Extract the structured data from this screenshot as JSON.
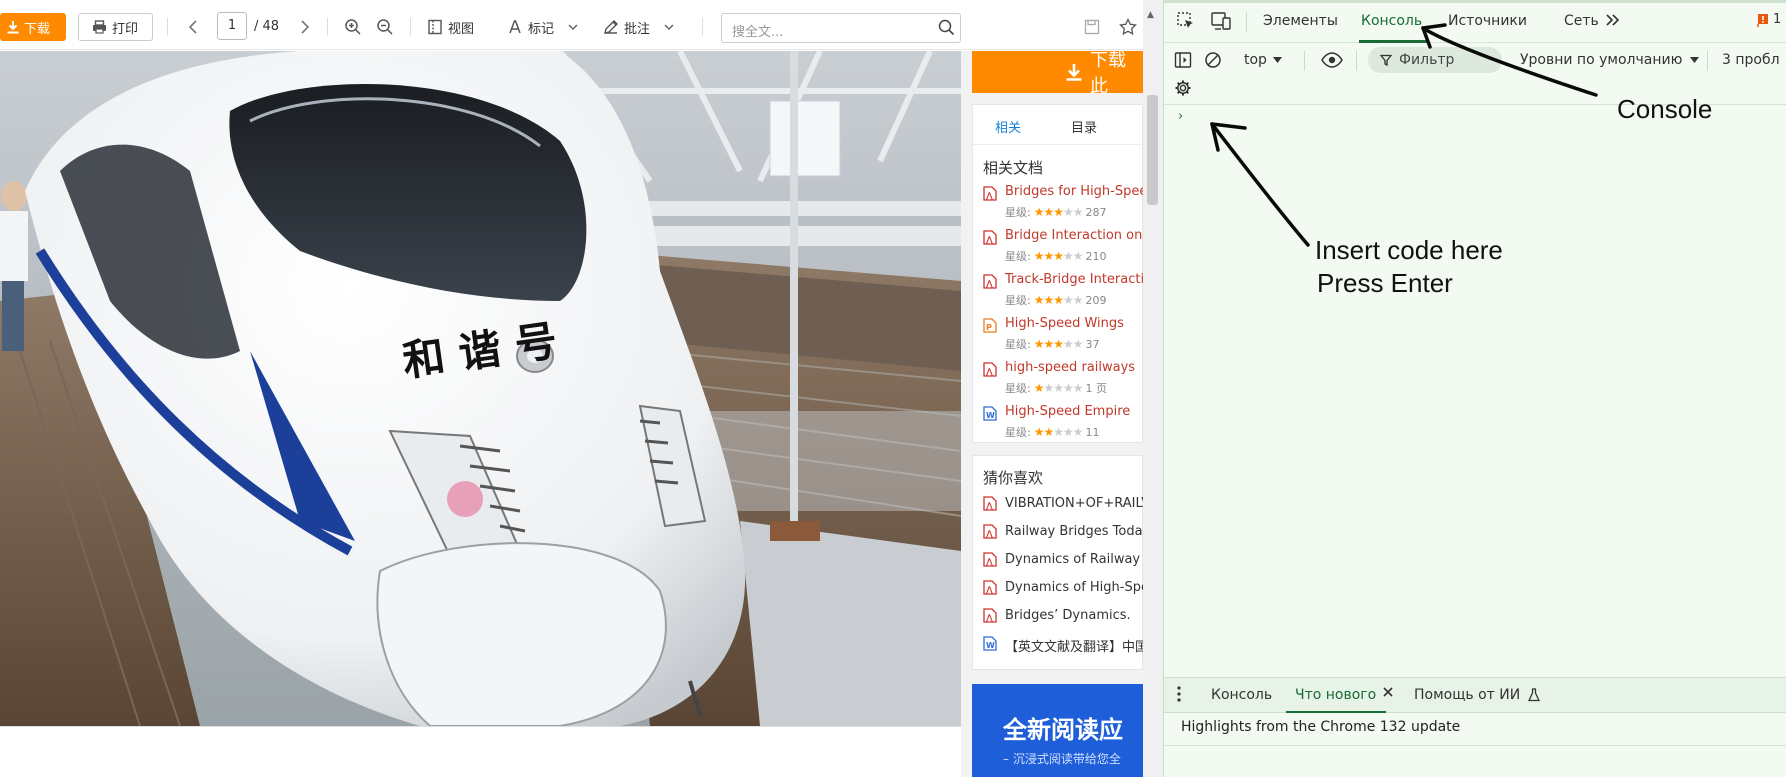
{
  "viewer": {
    "toolbar": {
      "download_label": "下载",
      "print_label": "打印",
      "page_current": "1",
      "page_total": "/ 48",
      "view_label": "视图",
      "mark_label": "标记",
      "annotate_label": "批注",
      "search_placeholder": "搜全文..."
    },
    "sidebar": {
      "download_doc_label": "下载此",
      "tabs": [
        {
          "label": "相关"
        },
        {
          "label": "目录"
        }
      ],
      "related_title": "相关文档",
      "related": [
        {
          "name": "Bridges for High-Spee",
          "rating_label": "星级:",
          "stars": 3,
          "meta": "287"
        },
        {
          "name": "Bridge Interaction on I",
          "rating_label": "星级:",
          "stars": 3,
          "meta": "210"
        },
        {
          "name": "Track-Bridge Interactic",
          "rating_label": "星级:",
          "stars": 3,
          "meta": "209"
        },
        {
          "name": "High-Speed Wings",
          "rating_label": "星级:",
          "stars": 3,
          "meta": "37"
        },
        {
          "name": "high-speed railways",
          "rating_label": "星级:",
          "stars": 1,
          "meta": "1 页"
        },
        {
          "name": "High-Speed Empire",
          "rating_label": "星级:",
          "stars": 2,
          "meta": "11"
        }
      ],
      "like_title": "猜你喜欢",
      "like": [
        {
          "name": "VIBRATION+OF+RAILV"
        },
        {
          "name": "Railway Bridges Today"
        },
        {
          "name": "Dynamics of Railway B"
        },
        {
          "name": "Dynamics of High-Spe"
        },
        {
          "name": "Bridges’   Dynamics."
        },
        {
          "name": "【英文文献及翻译】中国"
        }
      ],
      "ad_title": "全新阅读应",
      "ad_sub": "– 沉浸式阅读带给您全"
    },
    "train_text": "和 谐 号"
  },
  "devtools": {
    "tabs": [
      {
        "label": "Элементы"
      },
      {
        "label": "Консоль"
      },
      {
        "label": "Источники"
      },
      {
        "label": "Сеть"
      }
    ],
    "issues_count": "1",
    "context": "top",
    "filter_label": "Фильтр",
    "levels_label": "Уровни по умолчанию",
    "problems_label": "3 пробл",
    "prompt": "›",
    "drawer": {
      "tabs": [
        {
          "label": "Консоль"
        },
        {
          "label": "Что нового"
        },
        {
          "label": "Помощь от ИИ"
        }
      ],
      "highlights": "Highlights from the Chrome 132 update"
    }
  },
  "annotations": {
    "console": "Console",
    "insert_line1": "Insert code here",
    "insert_line2": "Press Enter"
  },
  "colors": {
    "download_orange": "#ff8a00",
    "devtools_bg": "#f2faf2",
    "devtools_accent": "#1a6b38",
    "link_red": "#c0392b",
    "ad_blue": "#1e5ed8"
  }
}
